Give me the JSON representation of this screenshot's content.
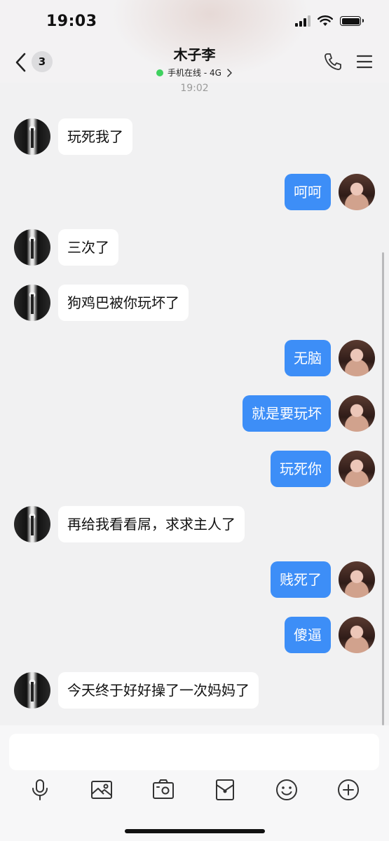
{
  "status_bar": {
    "time": "19:03"
  },
  "header": {
    "back_badge": "3",
    "title": "木子李",
    "subtitle": "手机在线 - 4G",
    "online_color": "#3fd15f"
  },
  "chat": {
    "timestamp": "19:02",
    "outgoing_color": "#3d8ef7",
    "messages": [
      {
        "side": "in",
        "text": "玩死我了"
      },
      {
        "side": "out",
        "text": "呵呵"
      },
      {
        "side": "in",
        "text": "三次了"
      },
      {
        "side": "in",
        "text": "狗鸡巴被你玩坏了"
      },
      {
        "side": "out",
        "text": "无脑"
      },
      {
        "side": "out",
        "text": "就是要玩坏"
      },
      {
        "side": "out",
        "text": "玩死你"
      },
      {
        "side": "in",
        "text": "再给我看看屌，求求主人了"
      },
      {
        "side": "out",
        "text": "贱死了"
      },
      {
        "side": "out",
        "text": "傻逼"
      },
      {
        "side": "in",
        "text": "今天终于好好操了一次妈妈了"
      }
    ]
  },
  "input": {
    "placeholder": "",
    "tools": [
      "microphone-icon",
      "image-icon",
      "camera-icon",
      "red-packet-icon",
      "emoji-icon",
      "plus-icon"
    ]
  }
}
